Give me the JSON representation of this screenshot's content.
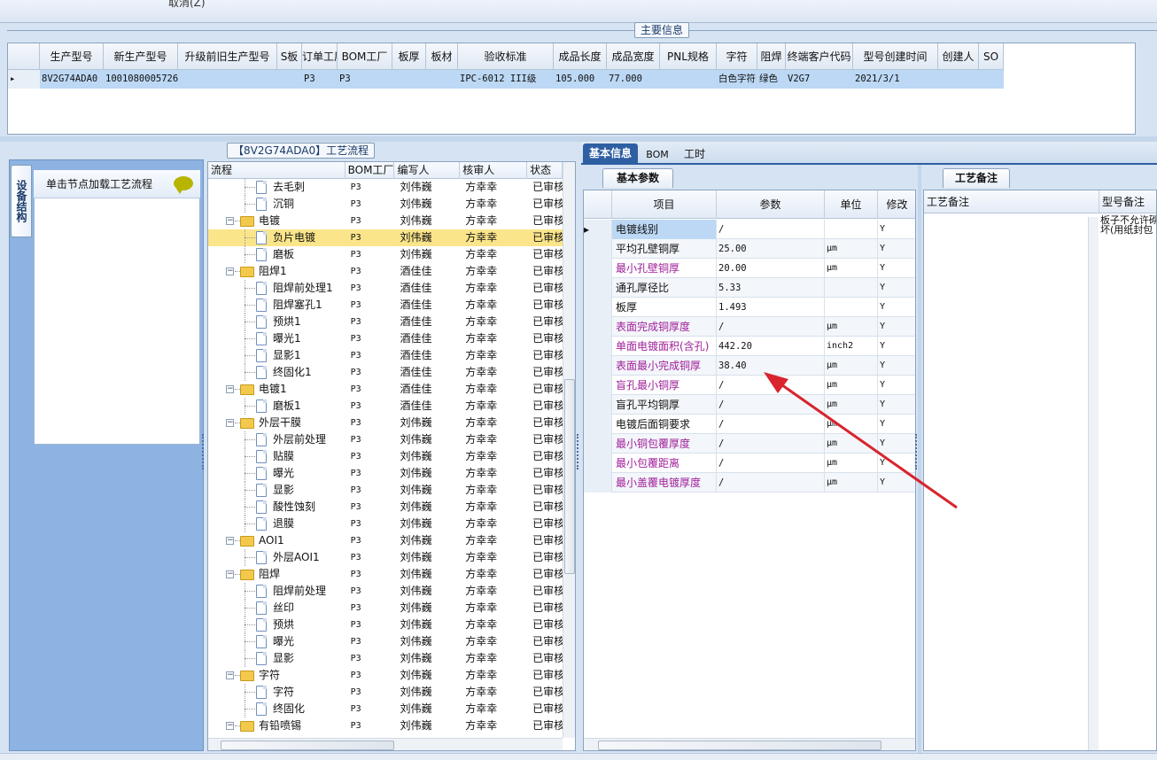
{
  "topbar": {
    "cancel_label": "取消(Z)"
  },
  "main_info": {
    "title": "主要信息",
    "columns": [
      "生产型号",
      "新生产型号",
      "升级前旧生产型号",
      "S板",
      "订单工厂",
      "BOM工厂",
      "板厚",
      "板材",
      "验收标准",
      "成品长度",
      "成品宽度",
      "PNL规格",
      "字符",
      "阻焊",
      "终端客户代码",
      "型号创建时间",
      "创建人",
      "SO"
    ],
    "row": [
      "8V2G74ADA0",
      "10010800057263",
      "",
      "",
      "P3",
      "P3",
      "",
      "",
      "IPC-6012 III级",
      "105.000",
      "77.000",
      "",
      "白色字符",
      "绿色",
      "V2G7",
      "2021/3/1",
      "",
      ""
    ]
  },
  "left_panel": {
    "vertical_tab": "设备结构",
    "load_button": "单击节点加载工艺流程"
  },
  "flow": {
    "title": "【8V2G74ADA0】工艺流程",
    "columns": [
      "流程",
      "BOM工厂",
      "编写人",
      "核审人",
      "状态"
    ],
    "rows": [
      {
        "name": "去毛刺",
        "level": 2,
        "folder": false,
        "bom": "P3",
        "author": "刘伟巍",
        "reviewer": "方幸幸",
        "status": "已审核"
      },
      {
        "name": "沉铜",
        "level": 2,
        "folder": false,
        "bom": "P3",
        "author": "刘伟巍",
        "reviewer": "方幸幸",
        "status": "已审核"
      },
      {
        "name": "电镀",
        "level": 1,
        "folder": true,
        "bom": "P3",
        "author": "刘伟巍",
        "reviewer": "方幸幸",
        "status": "已审核"
      },
      {
        "name": "负片电镀",
        "level": 2,
        "folder": false,
        "bom": "P3",
        "author": "刘伟巍",
        "reviewer": "方幸幸",
        "status": "已审核",
        "selected": true
      },
      {
        "name": "磨板",
        "level": 2,
        "folder": false,
        "bom": "P3",
        "author": "刘伟巍",
        "reviewer": "方幸幸",
        "status": "已审核"
      },
      {
        "name": "阻焊1",
        "level": 1,
        "folder": true,
        "bom": "P3",
        "author": "酒佳佳",
        "reviewer": "方幸幸",
        "status": "已审核"
      },
      {
        "name": "阻焊前处理1",
        "level": 2,
        "folder": false,
        "bom": "P3",
        "author": "酒佳佳",
        "reviewer": "方幸幸",
        "status": "已审核"
      },
      {
        "name": "阻焊塞孔1",
        "level": 2,
        "folder": false,
        "bom": "P3",
        "author": "酒佳佳",
        "reviewer": "方幸幸",
        "status": "已审核"
      },
      {
        "name": "预烘1",
        "level": 2,
        "folder": false,
        "bom": "P3",
        "author": "酒佳佳",
        "reviewer": "方幸幸",
        "status": "已审核"
      },
      {
        "name": "曝光1",
        "level": 2,
        "folder": false,
        "bom": "P3",
        "author": "酒佳佳",
        "reviewer": "方幸幸",
        "status": "已审核"
      },
      {
        "name": "显影1",
        "level": 2,
        "folder": false,
        "bom": "P3",
        "author": "酒佳佳",
        "reviewer": "方幸幸",
        "status": "已审核"
      },
      {
        "name": "终固化1",
        "level": 2,
        "folder": false,
        "bom": "P3",
        "author": "酒佳佳",
        "reviewer": "方幸幸",
        "status": "已审核"
      },
      {
        "name": "电镀1",
        "level": 1,
        "folder": true,
        "bom": "P3",
        "author": "酒佳佳",
        "reviewer": "方幸幸",
        "status": "已审核"
      },
      {
        "name": "磨板1",
        "level": 2,
        "folder": false,
        "bom": "P3",
        "author": "酒佳佳",
        "reviewer": "方幸幸",
        "status": "已审核"
      },
      {
        "name": "外层干膜",
        "level": 1,
        "folder": true,
        "bom": "P3",
        "author": "刘伟巍",
        "reviewer": "方幸幸",
        "status": "已审核"
      },
      {
        "name": "外层前处理",
        "level": 2,
        "folder": false,
        "bom": "P3",
        "author": "刘伟巍",
        "reviewer": "方幸幸",
        "status": "已审核"
      },
      {
        "name": "贴膜",
        "level": 2,
        "folder": false,
        "bom": "P3",
        "author": "刘伟巍",
        "reviewer": "方幸幸",
        "status": "已审核"
      },
      {
        "name": "曝光",
        "level": 2,
        "folder": false,
        "bom": "P3",
        "author": "刘伟巍",
        "reviewer": "方幸幸",
        "status": "已审核"
      },
      {
        "name": "显影",
        "level": 2,
        "folder": false,
        "bom": "P3",
        "author": "刘伟巍",
        "reviewer": "方幸幸",
        "status": "已审核"
      },
      {
        "name": "酸性蚀刻",
        "level": 2,
        "folder": false,
        "bom": "P3",
        "author": "刘伟巍",
        "reviewer": "方幸幸",
        "status": "已审核"
      },
      {
        "name": "退膜",
        "level": 2,
        "folder": false,
        "bom": "P3",
        "author": "刘伟巍",
        "reviewer": "方幸幸",
        "status": "已审核"
      },
      {
        "name": "AOI1",
        "level": 1,
        "folder": true,
        "bom": "P3",
        "author": "刘伟巍",
        "reviewer": "方幸幸",
        "status": "已审核"
      },
      {
        "name": "外层AOI1",
        "level": 2,
        "folder": false,
        "bom": "P3",
        "author": "刘伟巍",
        "reviewer": "方幸幸",
        "status": "已审核"
      },
      {
        "name": "阻焊",
        "level": 1,
        "folder": true,
        "bom": "P3",
        "author": "刘伟巍",
        "reviewer": "方幸幸",
        "status": "已审核"
      },
      {
        "name": "阻焊前处理",
        "level": 2,
        "folder": false,
        "bom": "P3",
        "author": "刘伟巍",
        "reviewer": "方幸幸",
        "status": "已审核"
      },
      {
        "name": "丝印",
        "level": 2,
        "folder": false,
        "bom": "P3",
        "author": "刘伟巍",
        "reviewer": "方幸幸",
        "status": "已审核"
      },
      {
        "name": "预烘",
        "level": 2,
        "folder": false,
        "bom": "P3",
        "author": "刘伟巍",
        "reviewer": "方幸幸",
        "status": "已审核"
      },
      {
        "name": "曝光",
        "level": 2,
        "folder": false,
        "bom": "P3",
        "author": "刘伟巍",
        "reviewer": "方幸幸",
        "status": "已审核"
      },
      {
        "name": "显影",
        "level": 2,
        "folder": false,
        "bom": "P3",
        "author": "刘伟巍",
        "reviewer": "方幸幸",
        "status": "已审核"
      },
      {
        "name": "字符",
        "level": 1,
        "folder": true,
        "bom": "P3",
        "author": "刘伟巍",
        "reviewer": "方幸幸",
        "status": "已审核"
      },
      {
        "name": "字符",
        "level": 2,
        "folder": false,
        "bom": "P3",
        "author": "刘伟巍",
        "reviewer": "方幸幸",
        "status": "已审核"
      },
      {
        "name": "终固化",
        "level": 2,
        "folder": false,
        "bom": "P3",
        "author": "刘伟巍",
        "reviewer": "方幸幸",
        "status": "已审核"
      },
      {
        "name": "有铅喷锡",
        "level": 1,
        "folder": true,
        "bom": "P3",
        "author": "刘伟巍",
        "reviewer": "方幸幸",
        "status": "已审核"
      }
    ]
  },
  "detail_tabs": [
    "基本信息",
    "BOM",
    "工时"
  ],
  "basic_params": {
    "tab": "基本参数",
    "columns": [
      "项目",
      "参数",
      "单位",
      "修改"
    ],
    "rows": [
      {
        "item": "电镀线别",
        "value": "/",
        "unit": "",
        "mod": "Y",
        "hl": false
      },
      {
        "item": "平均孔壁铜厚",
        "value": "25.00",
        "unit": "μm",
        "mod": "Y",
        "hl": false
      },
      {
        "item": "最小孔壁铜厚",
        "value": "20.00",
        "unit": "μm",
        "mod": "Y",
        "hl": true
      },
      {
        "item": "通孔厚径比",
        "value": "5.33",
        "unit": "",
        "mod": "Y",
        "hl": false
      },
      {
        "item": "板厚",
        "value": "1.493",
        "unit": "",
        "mod": "Y",
        "hl": false
      },
      {
        "item": "表面完成铜厚度",
        "value": "/",
        "unit": "μm",
        "mod": "Y",
        "hl": true
      },
      {
        "item": "单面电镀面积(含孔)",
        "value": "442.20",
        "unit": "inch2",
        "mod": "Y",
        "hl": true
      },
      {
        "item": "表面最小完成铜厚",
        "value": "38.40",
        "unit": "μm",
        "mod": "Y",
        "hl": true
      },
      {
        "item": "盲孔最小铜厚",
        "value": "/",
        "unit": "μm",
        "mod": "Y",
        "hl": true
      },
      {
        "item": "盲孔平均铜厚",
        "value": "/",
        "unit": "μm",
        "mod": "Y",
        "hl": false
      },
      {
        "item": "电镀后面铜要求",
        "value": "/",
        "unit": "μm",
        "mod": "Y",
        "hl": false
      },
      {
        "item": "最小铜包覆厚度",
        "value": "/",
        "unit": "μm",
        "mod": "Y",
        "hl": true
      },
      {
        "item": "最小包覆距离",
        "value": "/",
        "unit": "μm",
        "mod": "Y",
        "hl": true
      },
      {
        "item": "最小盖覆电镀厚度",
        "value": "/",
        "unit": "μm",
        "mod": "Y",
        "hl": true
      }
    ]
  },
  "remarks": {
    "tab": "工艺备注",
    "col1": "工艺备注",
    "col2": "型号备注",
    "model_remark": "板子不允许砌\n坏(用纸封包"
  },
  "colors": {
    "accent": "#2e5fa3",
    "selected_row": "#fbe58a",
    "highlight_text": "#a0209a",
    "arrow": "#d9232d"
  }
}
